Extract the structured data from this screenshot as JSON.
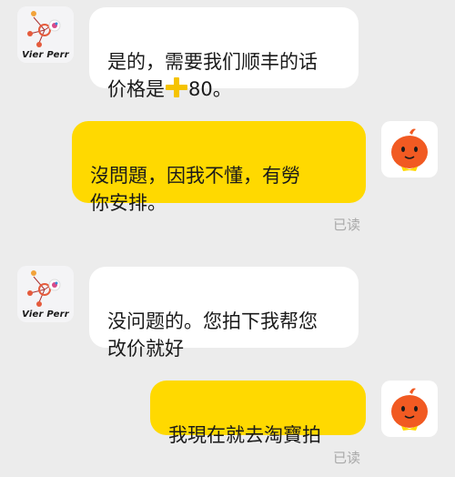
{
  "messages": [
    {
      "sender": "shop",
      "avatar_label": "Vier Perr",
      "text_before_icon": "是的，需要我们顺丰的话\n价格是",
      "icon": "plus-icon",
      "text_after_icon": "80。"
    },
    {
      "sender": "me",
      "text": "沒問題，因我不懂，有勞\n你安排。",
      "status": "已读"
    },
    {
      "sender": "shop",
      "avatar_label": "Vier Perr",
      "text": "没问题的。您拍下我帮您\n改价就好"
    },
    {
      "sender": "me",
      "text": "我現在就去淘寶拍",
      "status": "已读"
    }
  ],
  "colors": {
    "background": "#ececec",
    "incoming_bubble": "#ffffff",
    "outgoing_bubble": "#ffd900",
    "read_status": "#a9a9a9",
    "plus_icon": "#f5c300",
    "mascot": "#f15a22"
  }
}
